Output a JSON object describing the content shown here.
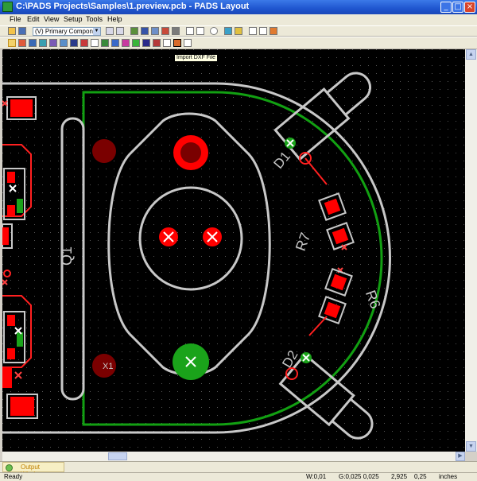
{
  "window": {
    "title": "C:\\PADS Projects\\Samples\\1.preview.pcb - PADS Layout",
    "minimize": "_",
    "maximize": "□",
    "close": "×"
  },
  "menu": [
    "File",
    "Edit",
    "View",
    "Setup",
    "Tools",
    "Help"
  ],
  "toolbar": {
    "layer_select": "(V) Primary Componer"
  },
  "tooltip": "Import DXF File",
  "pcb": {
    "labels": {
      "d1": "D1",
      "d2": "D2",
      "r7": "R7",
      "r6": "R6",
      "q1": "Q1",
      "x1": "X1"
    },
    "colors": {
      "background": "#000000",
      "outline": "#c8c8c8",
      "board": "#12a012",
      "pad": "#ff0000",
      "via": "#7a0000",
      "trace": "#ff2020",
      "green_pad": "#1aa31a"
    }
  },
  "output_window": "Output Window",
  "status": {
    "ready": "Ready",
    "w": "W:0,01",
    "g": "G:0,025 0,025",
    "x": "2,925",
    "y": "0,25",
    "units": "inches"
  }
}
